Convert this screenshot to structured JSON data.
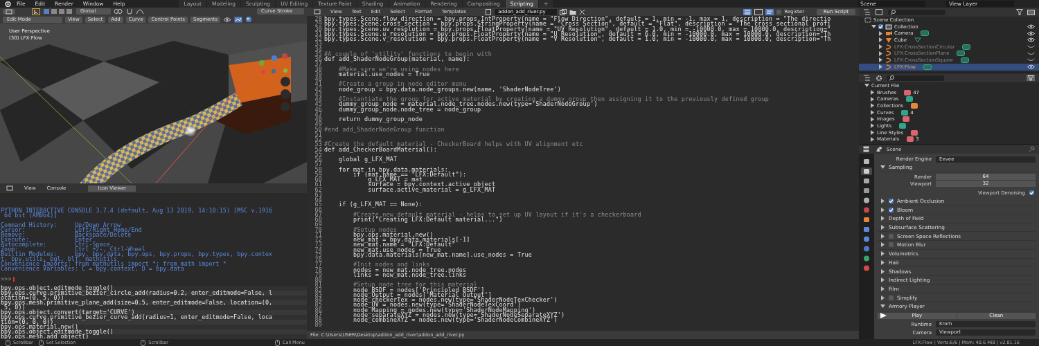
{
  "top_bar": {
    "menus": [
      "File",
      "Edit",
      "Render",
      "Window",
      "Help"
    ],
    "workspaces": [
      {
        "label": "Layout",
        "selected": false
      },
      {
        "label": "Modeling",
        "selected": false
      },
      {
        "label": "Sculpting",
        "selected": false
      },
      {
        "label": "UV Editing",
        "selected": false
      },
      {
        "label": "Texture Paint",
        "selected": false
      },
      {
        "label": "Shading",
        "selected": false
      },
      {
        "label": "Animation",
        "selected": false
      },
      {
        "label": "Rendering",
        "selected": false
      },
      {
        "label": "Compositing",
        "selected": false
      },
      {
        "label": "Scripting",
        "selected": true
      }
    ],
    "add_tab": "+",
    "scene": "Scene",
    "view_layer": "View Layer"
  },
  "viewport": {
    "orientation": "Global",
    "stroke_placement": "Curve Stroke",
    "mode": "Edit Mode",
    "menus": [
      "View",
      "Select",
      "Add",
      "Curve",
      "Control Points",
      "Segments"
    ],
    "overlay_lines": [
      "User Perspective",
      "(30) LFX:Flow"
    ]
  },
  "console": {
    "menus": [
      "View",
      "Console"
    ],
    "tab": "Icon Viewer",
    "output": [
      "PYTHON INTERACTIVE CONSOLE 3.7.4 (default, Aug 13 2019, 14:10:15) [MSC v.1916",
      " 64 bit (AMD64)]",
      "Command History:     Up/Down Arrow",
      "Cursor:              Left/Right Home/End",
      "Remove:              Backspace/Delete",
      "Execute:             Enter",
      "Autocomplete:        Ctrl-Space",
      "Zoom:                Ctrl +/-, Ctrl-Wheel",
      "Builtin Modules:     bpy, bpy.data, bpy.ops, bpy.props, bpy.types, bpy.contex",
      "t, bpy.utils, bgl, blf, mathutils",
      "Convenience Imports: from mathutils import *; from math import *",
      "Convenience Variables: C = bpy.context, D = bpy.data"
    ],
    "prompt": ">>>",
    "history": [
      "bpy.ops.object.editmode_toggle()",
      "bpy.ops.curve.primitive_bezier_circle_add(radius=0.2, enter_editmode=False, l",
      "ocation=(0, 5, 0))",
      "bpy.ops.mesh.primitive_plane_add(size=0.5, enter_editmode=False, location=(0,",
      " 5, 0))",
      "bpy.ops.object.convert(target='CURVE')",
      "bpy.ops.curve.primitive_bezier_curve_add(radius=1, enter_editmode=False, loca",
      "tion=(0, 0, 0))",
      "bpy.ops.material.new()",
      "bpy.ops.object.editmode_toggle()",
      "bpy.ops.mesh.add_object()"
    ]
  },
  "text_editor": {
    "menus": [
      "View",
      "Text",
      "Edit",
      "Select",
      "Format",
      "Templates"
    ],
    "filename": "addon_add_river.py",
    "register": {
      "label": "Register",
      "checked": false
    },
    "run_button": "Run Script",
    "lines": [
      {
        "n": "28",
        "kind": "code",
        "text": "bpy.types.Scene.flow_direction = bpy.props.IntProperty(name = \"Flow Direction\", default = 1, min = -1, max = 1, description = \"The directio"
      },
      {
        "n": "29",
        "kind": "code",
        "text": "bpy.types.Scene.cross_section = bpy.props.StringProperty(name = \"Cross Section\", default = \"Flat\", description = \"The cross sectional profi"
      },
      {
        "n": "30",
        "kind": "code",
        "text": "bpy.types.Scene.uv_resolution = bpy.props.FloatProperty(name = \"UV Resolution\", default = 1.0, min = -10000.0, max = 10000.0, description=\""
      },
      {
        "n": "31",
        "kind": "code",
        "text": "bpy.types.Scene.u_resolution = bpy.props.FloatProperty(name = \"U Resolution\", default = 6.0, min = -10000.0, max = 10000.0, description=\"Th"
      },
      {
        "n": "32",
        "kind": "code",
        "text": "bpy.types.Scene.v_resolution = bpy.props.FloatProperty(name = \"V Resolution\", default = 1.0, min = -10000.0, max = 10000.0, description=\"Th"
      },
      {
        "n": "33"
      },
      {
        "n": "34"
      },
      {
        "n": "35",
        "kind": "comment",
        "text": "#A couple of 'utility' functions to begin with"
      },
      {
        "n": "36",
        "kind": "code",
        "text": "def add_ShaderNodeGroup(material, name):"
      },
      {
        "n": "37"
      },
      {
        "n": "38",
        "kind": "comment",
        "text": "    #Make sure we're using nodes here"
      },
      {
        "n": "39",
        "kind": "code",
        "text": "    material.use_nodes = True"
      },
      {
        "n": "40"
      },
      {
        "n": "41",
        "kind": "comment",
        "text": "    #Create a group in node editor menu"
      },
      {
        "n": "42",
        "kind": "code",
        "text": "    node_group = bpy.data.node_groups.new(name, 'ShaderNodeTree')"
      },
      {
        "n": "43"
      },
      {
        "n": "44",
        "kind": "comment",
        "text": "    #Instantiate the group for active material by creating a dummy group then assigning it to the previously defined group"
      },
      {
        "n": "45",
        "kind": "code",
        "text": "    dummy_group_node = material.node_tree.nodes.new(type='ShaderNodeGroup')"
      },
      {
        "n": "46",
        "kind": "code",
        "text": "    dummy_group_node.node_tree = node_group"
      },
      {
        "n": "47"
      },
      {
        "n": "48",
        "kind": "code",
        "text": "    return dummy_group_node"
      },
      {
        "n": "49"
      },
      {
        "n": "50",
        "kind": "comment",
        "text": "#end add_ShaderNodeGroup function"
      },
      {
        "n": "51"
      },
      {
        "n": "52"
      },
      {
        "n": "53",
        "kind": "comment",
        "text": "#Create the default material - CheckerBoard helps with UV alignment etc"
      },
      {
        "n": "54",
        "kind": "code",
        "text": "def add_CheckerBoardMaterial():"
      },
      {
        "n": "55"
      },
      {
        "n": "56",
        "kind": "code",
        "text": "    global g_LFX_MAT"
      },
      {
        "n": "57"
      },
      {
        "n": "58",
        "kind": "code",
        "text": "    for mat in bpy.data.materials:"
      },
      {
        "n": "59",
        "kind": "code",
        "text": "        if (mat.name == \"LFX:Default\"):"
      },
      {
        "n": "60",
        "kind": "code",
        "text": "            g_LFX_MAT = mat"
      },
      {
        "n": "61",
        "kind": "code",
        "text": "            surface = bpy.context.active_object"
      },
      {
        "n": "62",
        "kind": "code",
        "text": "            surface.active_material = g_LFX_MAT"
      },
      {
        "n": "63"
      },
      {
        "n": "64"
      },
      {
        "n": "65",
        "kind": "code",
        "text": "    if (g_LFX_MAT == None):"
      },
      {
        "n": "66"
      },
      {
        "n": "67",
        "kind": "comment",
        "text": "        #Create new default material - helps to set up UV layout if it's a checkerboard"
      },
      {
        "n": "68",
        "kind": "code",
        "text": "        print(\"Creating LFX:Default material...\")"
      },
      {
        "n": "69"
      },
      {
        "n": "70",
        "kind": "comment",
        "text": "        #Setup nodes"
      },
      {
        "n": "71",
        "kind": "code",
        "text": "        bpy.ops.material.new()"
      },
      {
        "n": "72",
        "kind": "code",
        "text": "        new_mat = bpy.data.materials[-1]"
      },
      {
        "n": "73",
        "kind": "code",
        "text": "        new_mat.name = \"LFX:Default\""
      },
      {
        "n": "74",
        "kind": "code",
        "text": "        new_mat.use_nodes = True"
      },
      {
        "n": "75",
        "kind": "code",
        "text": "        bpy.data.materials[new_mat.name].use_nodes = True"
      },
      {
        "n": "76"
      },
      {
        "n": "77",
        "kind": "comment",
        "text": "        #Init nodes and links"
      },
      {
        "n": "78",
        "kind": "code",
        "text": "        nodes = new_mat.node_tree.nodes"
      },
      {
        "n": "79",
        "kind": "code",
        "text": "        links = new_mat.node_tree.links"
      },
      {
        "n": "80"
      },
      {
        "n": "81",
        "kind": "comment",
        "text": "        #Setup node tree for this material"
      },
      {
        "n": "82",
        "kind": "code",
        "text": "        node_BSDF = nodes['Principled BSDF']"
      },
      {
        "n": "83",
        "kind": "code",
        "text": "        node_Output = nodes['Material Output']"
      },
      {
        "n": "84",
        "kind": "code",
        "text": "        node_checkerTex = nodes.new(type='ShaderNodeTexChecker')"
      },
      {
        "n": "85",
        "kind": "code",
        "text": "        node_UV = nodes.new(type='ShaderNodeTexCoord')"
      },
      {
        "n": "86",
        "kind": "code",
        "text": "        node_Mapping = nodes.new(type='ShaderNodeMapping')"
      },
      {
        "n": "87",
        "kind": "code",
        "text": "        node_separateXYZ = nodes.new(type='ShaderNodeSeparateXYZ')"
      },
      {
        "n": "88",
        "kind": "code",
        "text": "        node_combineXYZ = nodes.new(type='ShaderNodeCombineXYZ')"
      },
      {
        "n": "89"
      }
    ],
    "file_path": "File: C:\\Users\\USER\\Desktop\\addon_add_river\\addon_add_river.py"
  },
  "outliner": {
    "tree": [
      {
        "label": "Scene Collection",
        "kind": "scene_collection",
        "children": [
          {
            "label": "Collection",
            "kind": "collection",
            "checked": true,
            "expanded": true,
            "visible": true,
            "children": [
              {
                "label": "Camera",
                "kind": "camera",
                "expanded": false,
                "visible": true,
                "selected": false
              },
              {
                "label": "Cube",
                "kind": "mesh",
                "expanded": false,
                "visible": true,
                "selected": false
              },
              {
                "label": "LFX:CrossSectionCircular",
                "kind": "curve",
                "expanded": false,
                "visible": false,
                "selected": false
              },
              {
                "label": "LFX:CrossSectionPlane",
                "kind": "curve",
                "expanded": false,
                "visible": false,
                "selected": false
              },
              {
                "label": "LFX:CrossSectionSquare",
                "kind": "curve",
                "expanded": false,
                "visible": false,
                "selected": false
              },
              {
                "label": "LFX:Flow",
                "kind": "curve",
                "expanded": false,
                "visible": true,
                "selected": true
              }
            ]
          }
        ]
      }
    ]
  },
  "data_browser": {
    "root": "Current File",
    "expanded": true,
    "items": [
      {
        "label": "Brushes",
        "color": "#d9666f",
        "count": "47"
      },
      {
        "label": "Cameras",
        "color": "#2fa58a"
      },
      {
        "label": "Collections",
        "color": "#e08a3a"
      },
      {
        "label": "Curves",
        "color": "#2fa58a",
        "count": "4"
      },
      {
        "label": "Images",
        "color": "#d9666f"
      },
      {
        "label": "Lights",
        "color": "#2fa58a"
      },
      {
        "label": "Line Styles",
        "color": "#d9666f"
      },
      {
        "label": "Materials",
        "color": "#d9666f",
        "count": "3"
      }
    ]
  },
  "properties": {
    "context": "Scene",
    "tabs": [
      {
        "kind": "tool",
        "selected": false
      },
      {
        "kind": "render",
        "selected": true
      },
      {
        "kind": "output",
        "selected": false
      },
      {
        "kind": "view_layer",
        "selected": false
      },
      {
        "kind": "scene",
        "selected": false
      },
      {
        "kind": "world",
        "selected": false
      },
      {
        "kind": "object",
        "selected": false
      },
      {
        "kind": "modifiers",
        "selected": false
      },
      {
        "kind": "particles",
        "selected": false
      },
      {
        "kind": "physics",
        "selected": false
      },
      {
        "kind": "constraints",
        "selected": false
      },
      {
        "kind": "material",
        "selected": false
      }
    ],
    "render_engine": {
      "label": "Render Engine",
      "value": "Eevee"
    },
    "sampling": {
      "label": "Sampling",
      "expanded": true,
      "fields": [
        {
          "label": "Render",
          "value": "64"
        },
        {
          "label": "Viewport",
          "value": "32"
        }
      ],
      "denoise": {
        "label": "Viewport Denoising",
        "checked": true
      }
    },
    "panels": [
      {
        "label": "Ambient Occlusion",
        "expanded": false,
        "checked": true
      },
      {
        "label": "Bloom",
        "expanded": false,
        "checked": true
      },
      {
        "label": "Depth of Field",
        "expanded": false
      },
      {
        "label": "Subsurface Scattering",
        "expanded": false
      },
      {
        "label": "Screen Space Reflections",
        "expanded": false,
        "checked": false
      },
      {
        "label": "Motion Blur",
        "expanded": false,
        "checked": false
      },
      {
        "label": "Volumetrics",
        "expanded": false
      },
      {
        "label": "Hair",
        "expanded": false
      },
      {
        "label": "Shadows",
        "expanded": false
      },
      {
        "label": "Indirect Lighting",
        "expanded": false
      },
      {
        "label": "Film",
        "expanded": false
      },
      {
        "label": "Simplify",
        "expanded": false,
        "checked": false
      }
    ],
    "armory": {
      "label": "Armory Player",
      "expanded": true,
      "buttons": [
        "Play",
        "Clean"
      ],
      "fields": [
        {
          "label": "Runtime",
          "value": "Krom"
        },
        {
          "label": "Camera",
          "value": "Viewport"
        }
      ]
    }
  },
  "status_bar": {
    "hints": [
      "Scrollbar",
      "Set Selection",
      "Scrollbar",
      "Call Menu"
    ],
    "stats": "LFX:Flow | Verts:6/6 | Mem: 40.6 MiB | v2.81.16"
  }
}
